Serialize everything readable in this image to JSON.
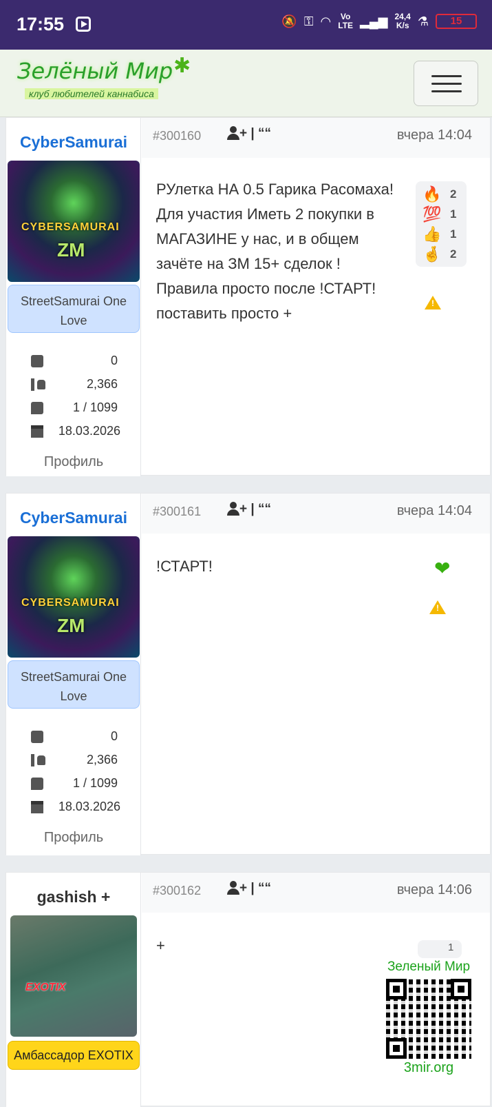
{
  "status_bar": {
    "time": "17:55",
    "net_top": "Vo",
    "net_bottom": "LTE",
    "speed_top": "24,4",
    "speed_bottom": "K/s",
    "battery": "15"
  },
  "header": {
    "logo_title": "Зелёный Мир",
    "logo_subtitle": "клуб любителей каннабиса",
    "menu_icon": "hamburger-icon"
  },
  "posts": [
    {
      "username": "CyberSamurai",
      "avatar_text_1": "CYBERSAMURAI",
      "avatar_text_2": "ZM",
      "role": "StreetSamurai One Love",
      "stats": {
        "purchases": "0",
        "likes": "2,366",
        "messages": "1 / 1099",
        "date": "18.03.2026"
      },
      "profile_label": "Профиль",
      "number": "#300160",
      "actions": "+ | ““",
      "time": "вчера 14:04",
      "body": "РУлетка НА 0.5 Гарика Расомаха!\nДля участия Иметь 2 покупки в МАГАЗИНЕ у нас, и в общем зачёте на ЗМ 15+ сделок !\nПравила просто после !СТАРТ! поставить просто +",
      "reactions": [
        {
          "emoji": "🔥",
          "count": "2"
        },
        {
          "emoji": "💯",
          "count": "1"
        },
        {
          "emoji": "👍",
          "count": "1"
        },
        {
          "emoji": "🤞",
          "count": "2"
        }
      ]
    },
    {
      "username": "CyberSamurai",
      "avatar_text_1": "CYBERSAMURAI",
      "avatar_text_2": "ZM",
      "role": "StreetSamurai One Love",
      "stats": {
        "purchases": "0",
        "likes": "2,366",
        "messages": "1 / 1099",
        "date": "18.03.2026"
      },
      "profile_label": "Профиль",
      "number": "#300161",
      "actions": "+ | ““",
      "time": "вчера 14:04",
      "body": "!СТАРТ!",
      "reaction_heart": "❤"
    },
    {
      "username": "gashish +",
      "avatar_text_1": "EXOTIX",
      "role": "Амбассадор EXOTIX",
      "number": "#300162",
      "actions": "+ | ““",
      "time": "вчера 14:06",
      "body": "+",
      "reaction_partial": "1"
    }
  ],
  "watermark": {
    "title": "Зеленый Мир",
    "footer": "3mir.org"
  },
  "colors": {
    "status_bar": "#3b2a6e",
    "username_link": "#1a6fd6",
    "role_badge": "#cfe2ff",
    "ambassador_badge": "#ffd51a",
    "brand_green": "#2aa02a"
  }
}
